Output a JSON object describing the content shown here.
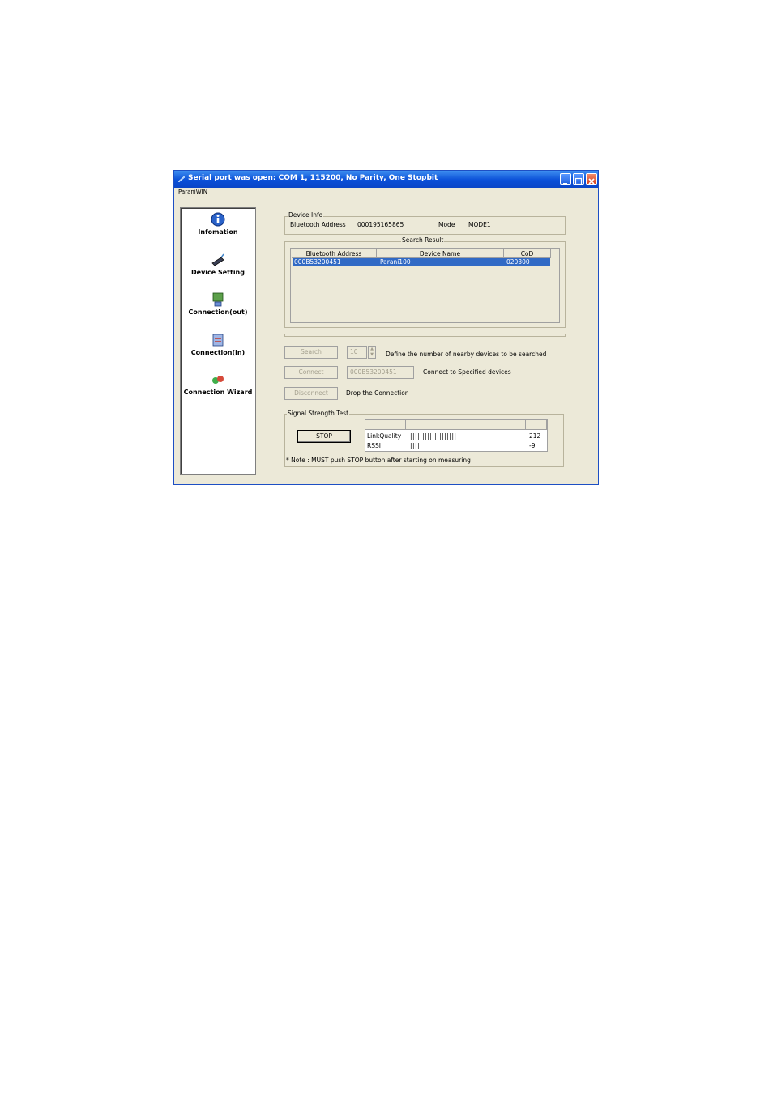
{
  "window": {
    "title": "Serial port was open: COM 1, 115200, No Parity, One Stopbit",
    "menu": "ParaniWIN"
  },
  "sidebar": {
    "items": [
      {
        "label": "Infomation",
        "icon": "info-icon"
      },
      {
        "label": "Device Setting",
        "icon": "device-setting-icon"
      },
      {
        "label": "Connection(out)",
        "icon": "connection-out-icon"
      },
      {
        "label": "Connection(in)",
        "icon": "connection-in-icon"
      },
      {
        "label": "Connection Wizard",
        "icon": "connection-wizard-icon"
      }
    ]
  },
  "device_info": {
    "group_label": "Device Info",
    "bt_address_label": "Bluetooth Address",
    "bt_address": "000195165865",
    "mode_label": "Mode",
    "mode": "MODE1"
  },
  "search_result": {
    "group_label": "Search Result",
    "columns": [
      "Bluetooth Address",
      "Device Name",
      "CoD"
    ],
    "rows": [
      {
        "address": "000B53200451",
        "name": "Parani100",
        "cod": "020300"
      }
    ]
  },
  "controls": {
    "search_label": "Search",
    "count_value": "10",
    "search_desc": "Define the number of nearby devices to be searched",
    "connect_label": "Connect",
    "connect_address": "000B53200451",
    "connect_desc": "Connect to Specified devices",
    "disconnect_label": "Disconnect",
    "disconnect_desc": "Drop the Connection"
  },
  "signal": {
    "group_label": "Signal Strength Test",
    "stop_label": "STOP",
    "rows": [
      {
        "name": "LinkQuality",
        "bar": "|||||||||||||||||||",
        "value": "212"
      },
      {
        "name": "RSSI",
        "bar": "|||||",
        "value": "-9"
      }
    ],
    "note": "* Note : MUST push STOP button after starting on measuring"
  },
  "colors": {
    "titlebar": "#0a4fd8",
    "face": "#ece9d8",
    "selection": "#316ac5"
  }
}
